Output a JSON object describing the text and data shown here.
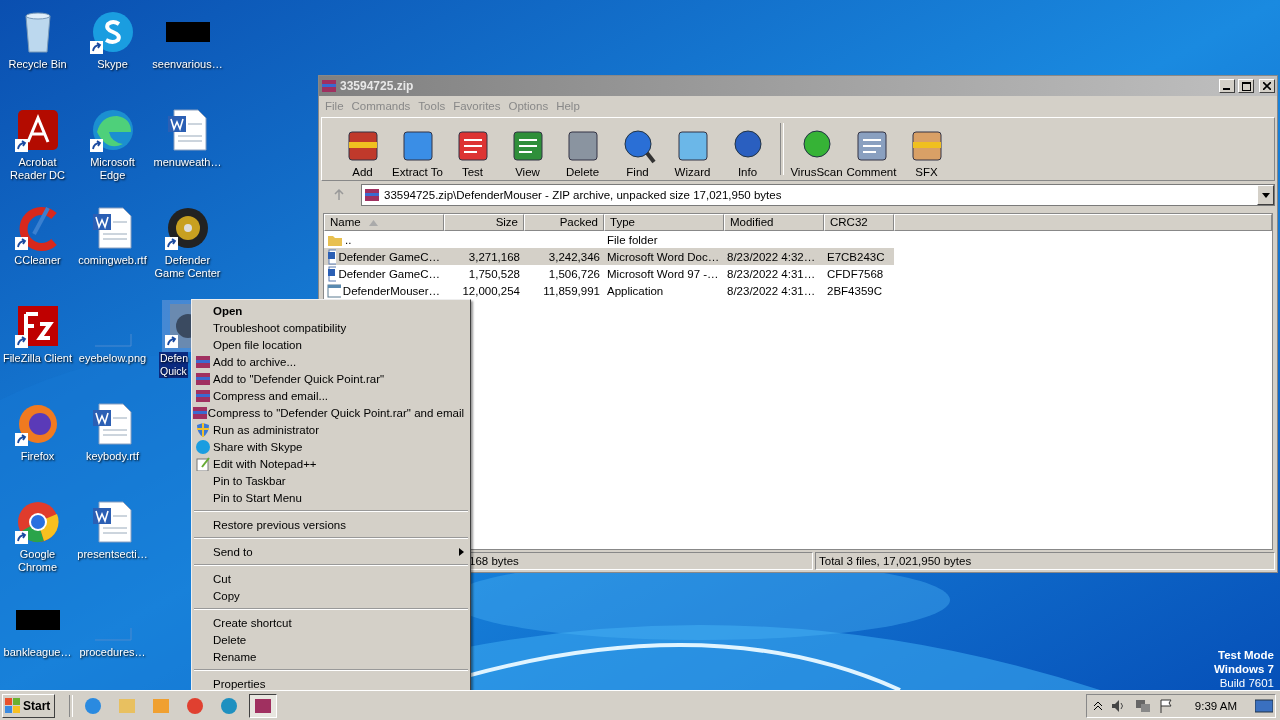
{
  "desktop": {
    "icons": [
      {
        "label": "Recycle Bin",
        "kind": "recycle",
        "shortcut": false,
        "selected": false
      },
      {
        "label": "Acrobat Reader DC",
        "kind": "pdf",
        "shortcut": true,
        "selected": false
      },
      {
        "label": "CCleaner",
        "kind": "ccleaner",
        "shortcut": true,
        "selected": false
      },
      {
        "label": "FileZilla Client",
        "kind": "filezilla",
        "shortcut": true,
        "selected": false
      },
      {
        "label": "Firefox",
        "kind": "firefox",
        "shortcut": true,
        "selected": false
      },
      {
        "label": "Google Chrome",
        "kind": "chrome",
        "shortcut": true,
        "selected": false
      },
      {
        "label": "bankleague…",
        "kind": "black",
        "shortcut": false,
        "selected": false
      },
      {
        "label": "Skype",
        "kind": "skype",
        "shortcut": true,
        "selected": false
      },
      {
        "label": "Microsoft Edge",
        "kind": "edge",
        "shortcut": true,
        "selected": false
      },
      {
        "label": "comingweb.rtf",
        "kind": "word",
        "shortcut": false,
        "selected": false
      },
      {
        "label": "eyebelow.png",
        "kind": "blank",
        "shortcut": false,
        "selected": false
      },
      {
        "label": "keybody.rtf",
        "kind": "word",
        "shortcut": false,
        "selected": false
      },
      {
        "label": "presentsecti…",
        "kind": "word",
        "shortcut": false,
        "selected": false
      },
      {
        "label": "procedures…",
        "kind": "blank",
        "shortcut": false,
        "selected": false
      },
      {
        "label": "seenvarious…",
        "kind": "black",
        "shortcut": false,
        "selected": false
      },
      {
        "label": "menuweath…",
        "kind": "word",
        "shortcut": false,
        "selected": false
      },
      {
        "label": "Defender Game Center",
        "kind": "disc",
        "shortcut": true,
        "selected": false
      },
      {
        "label": "Defen Quick",
        "kind": "app",
        "shortcut": true,
        "selected": true
      }
    ]
  },
  "window": {
    "title": "33594725.zip",
    "menu": [
      "File",
      "Commands",
      "Tools",
      "Favorites",
      "Options",
      "Help"
    ],
    "toolbar": [
      {
        "label": "Add",
        "kind": "add"
      },
      {
        "label": "Extract To",
        "kind": "extract"
      },
      {
        "label": "Test",
        "kind": "test"
      },
      {
        "label": "View",
        "kind": "view"
      },
      {
        "label": "Delete",
        "kind": "delete"
      },
      {
        "label": "Find",
        "kind": "find"
      },
      {
        "label": "Wizard",
        "kind": "wizard"
      },
      {
        "label": "Info",
        "kind": "info"
      },
      {
        "label": "VirusScan",
        "kind": "virus"
      },
      {
        "label": "Comment",
        "kind": "comment"
      },
      {
        "label": "SFX",
        "kind": "sfx"
      }
    ],
    "address": "33594725.zip\\DefenderMouser - ZIP archive, unpacked size 17,021,950 bytes",
    "table": {
      "columns": [
        {
          "label": "Name",
          "sorted": true
        },
        {
          "label": "Size",
          "sorted": false
        },
        {
          "label": "Packed",
          "sorted": false
        },
        {
          "label": "Type",
          "sorted": false
        },
        {
          "label": "Modified",
          "sorted": false
        },
        {
          "label": "CRC32",
          "sorted": false
        }
      ],
      "rows": [
        {
          "kind": "folder",
          "selected": false,
          "cells": [
            "..",
            "",
            "",
            "File folder",
            "",
            ""
          ]
        },
        {
          "kind": "word",
          "selected": true,
          "cells": [
            "Defender GameC…",
            "3,271,168",
            "3,242,346",
            "Microsoft Word Doc…",
            "8/23/2022 4:32…",
            "E7CB243C"
          ]
        },
        {
          "kind": "word",
          "selected": false,
          "cells": [
            "Defender GameC…",
            "1,750,528",
            "1,506,726",
            "Microsoft Word 97 -…",
            "8/23/2022 4:31…",
            "CFDF7568"
          ]
        },
        {
          "kind": "exe",
          "selected": false,
          "cells": [
            "DefenderMouser…",
            "12,000,254",
            "11,859,991",
            "Application",
            "8/23/2022 4:31…",
            "2BF4359C"
          ]
        }
      ]
    },
    "status_bar": [
      "168 bytes",
      "Total 3 files, 17,021,950 bytes"
    ]
  },
  "context_menu": [
    {
      "kind": "plain",
      "label": "Open",
      "bold": true
    },
    {
      "kind": "plain",
      "label": "Troubleshoot compatibility",
      "bold": false
    },
    {
      "kind": "plain",
      "label": "Open file location",
      "bold": false
    },
    {
      "kind": "winrar",
      "label": "Add to archive...",
      "bold": false
    },
    {
      "kind": "winrar",
      "label": "Add to \"Defender Quick Point.rar\"",
      "bold": false
    },
    {
      "kind": "winrar",
      "label": "Compress and email...",
      "bold": false
    },
    {
      "kind": "winrar",
      "label": "Compress to \"Defender Quick Point.rar\" and email",
      "bold": false
    },
    {
      "kind": "shield",
      "label": "Run as administrator",
      "bold": false
    },
    {
      "kind": "skype",
      "label": "Share with Skype",
      "bold": false
    },
    {
      "kind": "notepad",
      "label": "Edit with Notepad++",
      "bold": false
    },
    {
      "kind": "plain",
      "label": "Pin to Taskbar",
      "bold": false
    },
    {
      "kind": "plain",
      "label": "Pin to Start Menu",
      "bold": false
    },
    {
      "kind": "separator"
    },
    {
      "kind": "plain",
      "label": "Restore previous versions",
      "bold": false
    },
    {
      "kind": "separator"
    },
    {
      "kind": "submenu",
      "label": "Send to",
      "bold": false
    },
    {
      "kind": "separator"
    },
    {
      "kind": "plain",
      "label": "Cut",
      "bold": false
    },
    {
      "kind": "plain",
      "label": "Copy",
      "bold": false
    },
    {
      "kind": "separator"
    },
    {
      "kind": "plain",
      "label": "Create shortcut",
      "bold": false
    },
    {
      "kind": "plain",
      "label": "Delete",
      "bold": false
    },
    {
      "kind": "plain",
      "label": "Rename",
      "bold": false
    },
    {
      "kind": "separator"
    },
    {
      "kind": "plain",
      "label": "Properties",
      "bold": false
    }
  ],
  "test_mode": [
    "Test Mode",
    "Windows 7",
    "Build 7601"
  ],
  "taskbar": {
    "start": "Start",
    "apps": [
      {
        "kind": "ie",
        "active": false
      },
      {
        "kind": "explorer",
        "active": false
      },
      {
        "kind": "media",
        "active": false
      },
      {
        "kind": "chrome",
        "active": false
      },
      {
        "kind": "edge",
        "active": false
      },
      {
        "kind": "winrar",
        "active": true
      }
    ],
    "time": "9:39 AM"
  }
}
